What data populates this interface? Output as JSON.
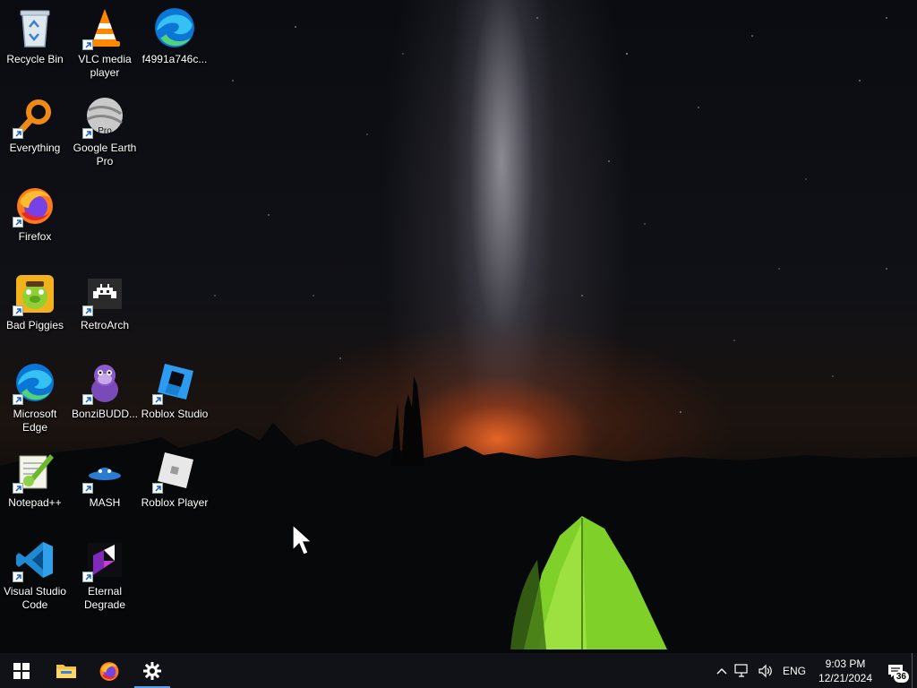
{
  "desktop": {
    "icons": [
      {
        "id": "recycle-bin",
        "label": "Recycle Bin",
        "icon": "recycle-bin-icon",
        "shortcut": false
      },
      {
        "id": "vlc",
        "label": "VLC media player",
        "icon": "vlc-icon",
        "shortcut": true
      },
      {
        "id": "edge-file",
        "label": "f4991a746c...",
        "icon": "edge-icon",
        "shortcut": false
      },
      {
        "id": "everything",
        "label": "Everything",
        "icon": "magnifier-icon",
        "shortcut": true
      },
      {
        "id": "google-earth",
        "label": "Google Earth Pro",
        "icon": "google-earth-icon",
        "shortcut": true,
        "badge": "Pro"
      },
      {
        "id": "firefox",
        "label": "Firefox",
        "icon": "firefox-icon",
        "shortcut": true
      },
      {
        "id": "bad-piggies",
        "label": "Bad Piggies",
        "icon": "bad-piggies-icon",
        "shortcut": true
      },
      {
        "id": "retroarch",
        "label": "RetroArch",
        "icon": "retroarch-icon",
        "shortcut": true
      },
      {
        "id": "microsoft-edge",
        "label": "Microsoft Edge",
        "icon": "edge-icon",
        "shortcut": true
      },
      {
        "id": "bonzibuddy",
        "label": "BonziBUDD...",
        "icon": "bonzibuddy-icon",
        "shortcut": true
      },
      {
        "id": "roblox-studio",
        "label": "Roblox Studio",
        "icon": "roblox-studio-icon",
        "shortcut": true
      },
      {
        "id": "notepadpp",
        "label": "Notepad++",
        "icon": "notepadpp-icon",
        "shortcut": true
      },
      {
        "id": "mash",
        "label": "MASH",
        "icon": "mash-icon",
        "shortcut": true
      },
      {
        "id": "roblox-player",
        "label": "Roblox Player",
        "icon": "roblox-player-icon",
        "shortcut": true
      },
      {
        "id": "vscode",
        "label": "Visual Studio Code",
        "icon": "vscode-icon",
        "shortcut": true
      },
      {
        "id": "eternal-degrade",
        "label": "Eternal Degrade",
        "icon": "eternal-degrade-icon",
        "shortcut": true
      }
    ]
  },
  "taskbar": {
    "pinned": [
      {
        "id": "start",
        "icon": "windows-logo-icon"
      },
      {
        "id": "file-explorer",
        "icon": "folder-icon"
      },
      {
        "id": "firefox",
        "icon": "firefox-icon"
      },
      {
        "id": "settings",
        "icon": "gear-icon",
        "active": true
      }
    ],
    "tray": {
      "language": "ENG",
      "time": "9:03 PM",
      "date": "12/21/2024",
      "notification_count": "36"
    }
  },
  "colors": {
    "taskbar_bg": "#101217",
    "accent": "#5aa0e8"
  }
}
